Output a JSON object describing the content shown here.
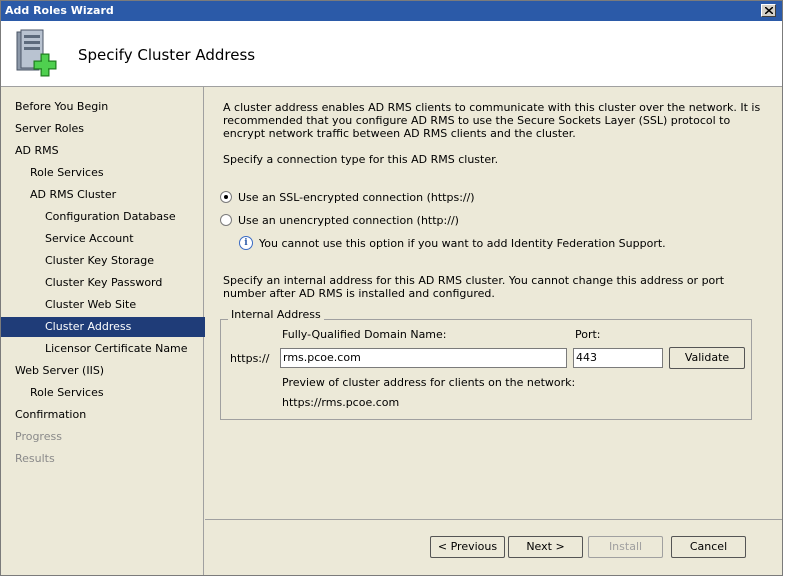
{
  "window": {
    "title": "Add Roles Wizard"
  },
  "header": {
    "title": "Specify Cluster Address"
  },
  "nav": {
    "items": [
      {
        "label": "Before You Begin"
      },
      {
        "label": "Server Roles"
      },
      {
        "label": "AD RMS"
      },
      {
        "label": "Role Services"
      },
      {
        "label": "AD RMS Cluster"
      },
      {
        "label": "Configuration Database"
      },
      {
        "label": "Service Account"
      },
      {
        "label": "Cluster Key Storage"
      },
      {
        "label": "Cluster Key Password"
      },
      {
        "label": "Cluster Web Site"
      },
      {
        "label": "Cluster Address",
        "selected": true
      },
      {
        "label": "Licensor Certificate Name"
      },
      {
        "label": "Web Server (IIS)"
      },
      {
        "label": "Role Services"
      },
      {
        "label": "Confirmation"
      },
      {
        "label": "Progress",
        "disabled": true
      },
      {
        "label": "Results",
        "disabled": true
      }
    ]
  },
  "content": {
    "intro": "A cluster address enables AD RMS clients to communicate with this cluster over the network. It is recommended that you configure AD RMS to use the Secure Sockets Layer (SSL) protocol to encrypt network traffic between AD RMS clients and the cluster.",
    "connection_prompt": "Specify a connection type for this AD RMS cluster.",
    "ssl_option": "Use an SSL-encrypted connection (https://)",
    "unencrypted_option": "Use an unencrypted connection (http://)",
    "info_note": "You cannot use this option if you want to add Identity Federation Support.",
    "address_prompt": "Specify an internal address for this AD RMS cluster. You cannot change this address or port number after AD RMS is installed and configured.",
    "group_title": "Internal Address",
    "fqdn_label": "Fully-Qualified Domain Name:",
    "port_label": "Port:",
    "scheme": "https://",
    "fqdn_value": "rms.pcoe.com",
    "port_value": "443",
    "validate_button": "Validate",
    "preview_label": "Preview of cluster address for clients on the network:",
    "preview_value": "https://rms.pcoe.com"
  },
  "footer": {
    "previous": "< Previous",
    "next": "Next >",
    "install": "Install",
    "cancel": "Cancel"
  },
  "colors": {
    "titlebar": "#2b5aa8",
    "selected": "#1f3c78",
    "panel": "#ece9d8"
  }
}
